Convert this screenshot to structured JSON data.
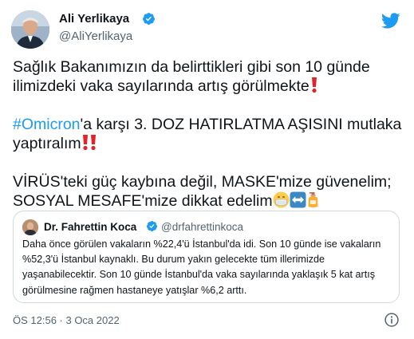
{
  "author": {
    "name": "Ali Yerlikaya",
    "handle": "@AliYerlikaya"
  },
  "tweet": {
    "line1": "Sağlık Bakanımızın da belirttikleri gibi son 10 günde ilimizdeki vaka sayılarında artış görülmekte",
    "hashtag": "#Omicron",
    "line2_rest": "'a karşı 3. DOZ HATIRLATMA AŞISINI mutlaka yaptıralım",
    "line3": "VİRÜS'teki güç kaybına değil, MASKE'mize güvenelim; SOSYAL MESAFE'mize dikkat edelim"
  },
  "quote": {
    "name": "Dr. Fahrettin Koca",
    "handle": "@drfahrettinkoca",
    "text": "Daha önce görülen vakaların %22,4'ü İstanbul'da idi. Son 10 günde ise vakaların %52,3'ü İstanbul kaynaklı. Bu durum yakın gelecekte tüm illerimizde yaşanabilecektir. Son 10 günde İstanbul'da vaka sayılarında yaklaşık 5 kat artış görülmesine rağmen hastaneye yatışlar %6,2 arttı."
  },
  "footer": {
    "timestamp": "ÖS 12:56 · 3 Oca 2022"
  },
  "icons": {
    "brand": "twitter-bird",
    "verified": "verified-badge",
    "info": "info"
  },
  "colors": {
    "link": "#1d9bf0",
    "verified": "#1d9bf0",
    "border": "#cfd9de",
    "secondary_text": "#536471"
  }
}
